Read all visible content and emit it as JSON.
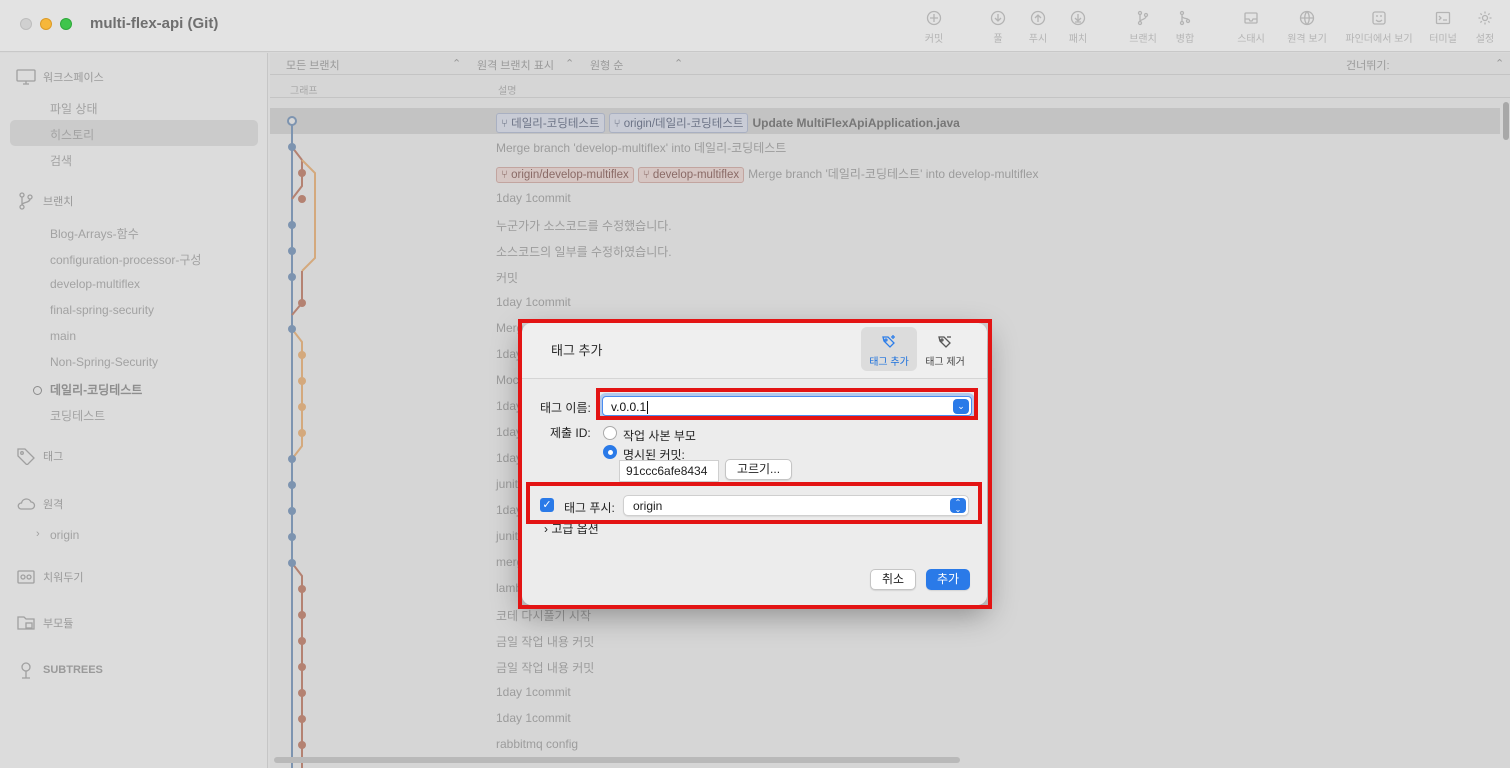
{
  "window": {
    "title": "multi-flex-api (Git)"
  },
  "toolbar": [
    {
      "label": "커밋",
      "icon": "commit-icon"
    },
    {
      "label": "풀",
      "icon": "pull-icon"
    },
    {
      "label": "푸시",
      "icon": "push-icon"
    },
    {
      "label": "패치",
      "icon": "fetch-icon"
    },
    {
      "label": "브랜치",
      "icon": "branch-icon"
    },
    {
      "label": "병합",
      "icon": "merge-icon"
    },
    {
      "label": "스태시",
      "icon": "stash-icon"
    },
    {
      "label": "원격 보기",
      "icon": "remote-view-icon"
    },
    {
      "label": "파인더에서 보기",
      "icon": "finder-icon"
    },
    {
      "label": "터미널",
      "icon": "terminal-icon"
    },
    {
      "label": "설정",
      "icon": "gear-icon"
    }
  ],
  "sidebar": {
    "workspace": {
      "title": "워크스페이스",
      "items": [
        "파일 상태",
        "히스토리",
        "검색"
      ]
    },
    "branches": {
      "title": "브랜치",
      "items": [
        "Blog-Arrays-함수",
        "configuration-processor-구성",
        "develop-multiflex",
        "final-spring-security",
        "main",
        "Non-Spring-Security",
        "데일리-코딩테스트",
        "코딩테스트"
      ]
    },
    "tags": {
      "title": "태그"
    },
    "remotes": {
      "title": "원격",
      "items": [
        "origin"
      ]
    },
    "stashes": {
      "title": "치워두기"
    },
    "submodules": {
      "title": "부모듈"
    },
    "subtrees": {
      "title": "SUBTREES"
    }
  },
  "filters": {
    "branches": "모든 브랜치",
    "remote": "원격 브랜치 표시",
    "order": "원형 순",
    "jump": "건너뛰기:"
  },
  "columns": {
    "graph": "그래프",
    "description": "설명"
  },
  "commits": [
    {
      "refs": [
        {
          "name": "데일리-코딩테스트",
          "type": "blue"
        },
        {
          "name": "origin/데일리-코딩테스트",
          "type": "blue"
        }
      ],
      "message": "Update MultiFlexApiApplication.java"
    },
    {
      "refs": [],
      "message": "Merge branch 'develop-multiflex' into 데일리-코딩테스트"
    },
    {
      "refs": [
        {
          "name": "origin/develop-multiflex",
          "type": "red"
        },
        {
          "name": "develop-multiflex",
          "type": "red"
        }
      ],
      "message": "Merge branch '데일리-코딩테스트' into develop-multiflex"
    },
    {
      "refs": [],
      "message": "1day 1commit"
    },
    {
      "refs": [],
      "message": "누군가가 소스코드를 수정했습니다."
    },
    {
      "refs": [],
      "message": "소스코드의 일부를 수정하였습니다."
    },
    {
      "refs": [],
      "message": "커밋"
    },
    {
      "refs": [],
      "message": "1day 1commit"
    },
    {
      "refs": [],
      "message": "Merg"
    },
    {
      "refs": [],
      "message": "1day"
    },
    {
      "refs": [],
      "message": "Moc"
    },
    {
      "refs": [],
      "message": "1day"
    },
    {
      "refs": [],
      "message": "1day"
    },
    {
      "refs": [],
      "message": "1day"
    },
    {
      "refs": [],
      "message": "junit"
    },
    {
      "refs": [],
      "message": "1day"
    },
    {
      "refs": [],
      "message": "junit"
    },
    {
      "refs": [],
      "message": "merg"
    },
    {
      "refs": [],
      "message": "lamb"
    },
    {
      "refs": [],
      "message": "코테 다시풀기 시작"
    },
    {
      "refs": [],
      "message": "금일 작업 내용 커밋"
    },
    {
      "refs": [],
      "message": "금일 작업 내용 커밋"
    },
    {
      "refs": [],
      "message": "1day 1commit"
    },
    {
      "refs": [],
      "message": "1day 1commit"
    },
    {
      "refs": [],
      "message": "rabbitmq config"
    }
  ],
  "dialog": {
    "title": "태그 추가",
    "segments": {
      "add": "태그 추가",
      "remove": "태그 제거"
    },
    "tag_name_label": "태그 이름:",
    "tag_name_value": "v.0.0.1",
    "commit_id_label": "제출 ID:",
    "option_working_copy": "작업 사본 부모",
    "option_specified": "명시된 커밋:",
    "commit_hash": "91ccc6afe8434",
    "choose_button": "고르기...",
    "push_tag_label": "태그 푸시:",
    "push_remote": "origin",
    "advanced": "고급 옵션",
    "cancel": "취소",
    "add": "추가"
  }
}
